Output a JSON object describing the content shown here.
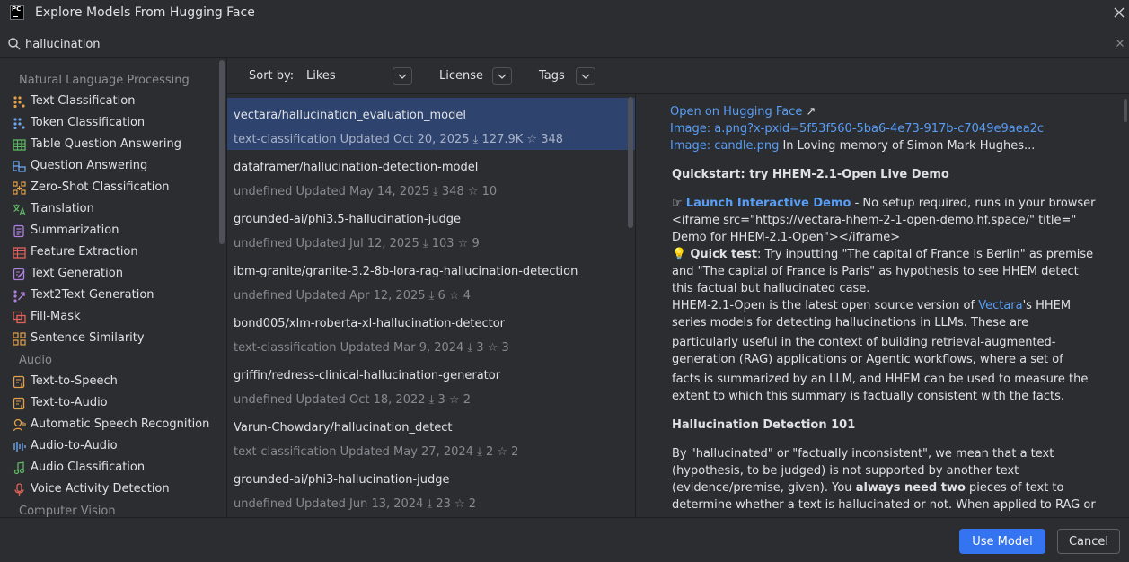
{
  "window": {
    "title": "Explore Models From Hugging Face",
    "logo_text": "PC"
  },
  "search": {
    "value": "hallucination",
    "placeholder": ""
  },
  "sidebar": {
    "groups": [
      {
        "heading": "Natural Language Processing"
      },
      {
        "heading": "Audio"
      },
      {
        "heading": "Computer Vision"
      }
    ],
    "items": [
      {
        "label": "Text Classification",
        "icon": "text-classification-icon",
        "color": "#e5a04a"
      },
      {
        "label": "Token Classification",
        "icon": "token-classification-icon",
        "color": "#6ea5f0"
      },
      {
        "label": "Table Question Answering",
        "icon": "table-icon",
        "color": "#5fb865"
      },
      {
        "label": "Question Answering",
        "icon": "question-answering-icon",
        "color": "#6ea5f0"
      },
      {
        "label": "Zero-Shot Classification",
        "icon": "zero-shot-icon",
        "color": "#e5a04a"
      },
      {
        "label": "Translation",
        "icon": "translation-icon",
        "color": "#5fb865"
      },
      {
        "label": "Summarization",
        "icon": "summarization-icon",
        "color": "#b07fe0"
      },
      {
        "label": "Feature Extraction",
        "icon": "feature-extraction-icon",
        "color": "#e0625a"
      },
      {
        "label": "Text Generation",
        "icon": "text-generation-icon",
        "color": "#b07fe0"
      },
      {
        "label": "Text2Text Generation",
        "icon": "text2text-generation-icon",
        "color": "#b07fe0"
      },
      {
        "label": "Fill-Mask",
        "icon": "fill-mask-icon",
        "color": "#e0625a"
      },
      {
        "label": "Sentence Similarity",
        "icon": "sentence-similarity-icon",
        "color": "#e5a04a"
      },
      {
        "label": "Text-to-Speech",
        "icon": "text-to-speech-icon",
        "color": "#e5a04a"
      },
      {
        "label": "Text-to-Audio",
        "icon": "text-to-audio-icon",
        "color": "#e5a04a"
      },
      {
        "label": "Automatic Speech Recognition",
        "icon": "speech-recognition-icon",
        "color": "#e5a04a"
      },
      {
        "label": "Audio-to-Audio",
        "icon": "audio-to-audio-icon",
        "color": "#6ea5f0"
      },
      {
        "label": "Audio Classification",
        "icon": "audio-classification-icon",
        "color": "#5fb865"
      },
      {
        "label": "Voice Activity Detection",
        "icon": "voice-activity-icon",
        "color": "#e0625a"
      }
    ]
  },
  "sortbar": {
    "sort_label": "Sort by:",
    "sort_value": "Likes",
    "license_label": "License",
    "tags_label": "Tags"
  },
  "models": [
    {
      "name": "vectara/hallucination_evaluation_model",
      "meta": "text-classification Updated Oct 20, 2025 ⤓ 127.9K ☆ 348",
      "selected": true
    },
    {
      "name": "dataframer/hallucination-detection-model",
      "meta": "undefined Updated May 14, 2025 ⤓ 348 ☆ 10"
    },
    {
      "name": "grounded-ai/phi3.5-hallucination-judge",
      "meta": "undefined Updated Jul 12, 2025 ⤓ 103 ☆ 9"
    },
    {
      "name": "ibm-granite/granite-3.2-8b-lora-rag-hallucination-detection",
      "meta": "undefined Updated Apr 12, 2025 ⤓ 6 ☆ 4"
    },
    {
      "name": "bond005/xlm-roberta-xl-hallucination-detector",
      "meta": "text-classification Updated Mar 9, 2024 ⤓ 3 ☆ 3"
    },
    {
      "name": "griffin/redress-clinical-hallucination-generator",
      "meta": "undefined Updated Oct 18, 2022 ⤓ 3 ☆ 2"
    },
    {
      "name": "Varun-Chowdary/hallucination_detect",
      "meta": "text-classification Updated May 27, 2024 ⤓ 2 ☆ 2"
    },
    {
      "name": "grounded-ai/phi3-hallucination-judge",
      "meta": "undefined Updated Jun 13, 2024 ⤓ 23 ☆ 2"
    }
  ],
  "detail": {
    "open_link": "Open on Hugging Face",
    "open_arrow": "↗",
    "image1": "Image: a.png?x-pxid=5f53f560-5ba6-4e73-917b-c7049e9aea2c",
    "image2_link": "Image: candle.png",
    "image2_rest": " In Loving memory of Simon Mark Hughes...",
    "quickstart_heading": "Quickstart: try HHEM-2.1-Open Live Demo",
    "launch_emoji": "☞",
    "launch_link": "Launch Interactive Demo",
    "launch_rest": " - No setup required, runs in your browser",
    "iframe_line1": "<iframe src=\"https://vectara-hhem-2-1-open-demo.hf.space/\" title=\"",
    "iframe_line2": "Demo for HHEM-2.1-Open\"></iframe>",
    "quicktest_emoji": "💡",
    "quicktest_bold": "Quick test",
    "quicktest_rest1": ": Try inputting \"The capital of France is Berlin\" as premise",
    "quicktest_rest2": "and \"The capital of France is Paris\" as hypothesis to see HHEM detect",
    "quicktest_rest3": "this factual but hallucinated case.",
    "hhem_pre": "HHEM-2.1-Open is the latest open source version of ",
    "hhem_link": "Vectara",
    "hhem_post": "'s HHEM",
    "hhem_l2": "series models for detecting hallucinations in LLMs. These are",
    "hhem_l3": "particularly useful in the context of building retrieval-augmented-",
    "hhem_l4": "generation (RAG) applications or Agentic workflows, where a set of",
    "hhem_l5": "facts is summarized by an LLM, and HHEM can be used to measure the",
    "hhem_l6": "extent to which this summary is factually consistent with the facts.",
    "detection_heading": "Hallucination Detection 101",
    "d_l1": "By \"hallucinated\" or \"factually inconsistent\", we mean that a text",
    "d_l2": "(hypothesis, to be judged) is not supported by another text",
    "d_l3_pre": "(evidence/premise, given). You ",
    "d_l3_bold": "always need two",
    "d_l3_post": " pieces of text to",
    "d_l4": "determine whether a text is hallucinated or not. When applied to RAG or"
  },
  "footer": {
    "primary": "Use Model",
    "secondary": "Cancel"
  },
  "colors": {
    "background": "#2b2d30",
    "selection": "#2e436e",
    "link": "#589df6",
    "primary_button": "#3574f0"
  }
}
